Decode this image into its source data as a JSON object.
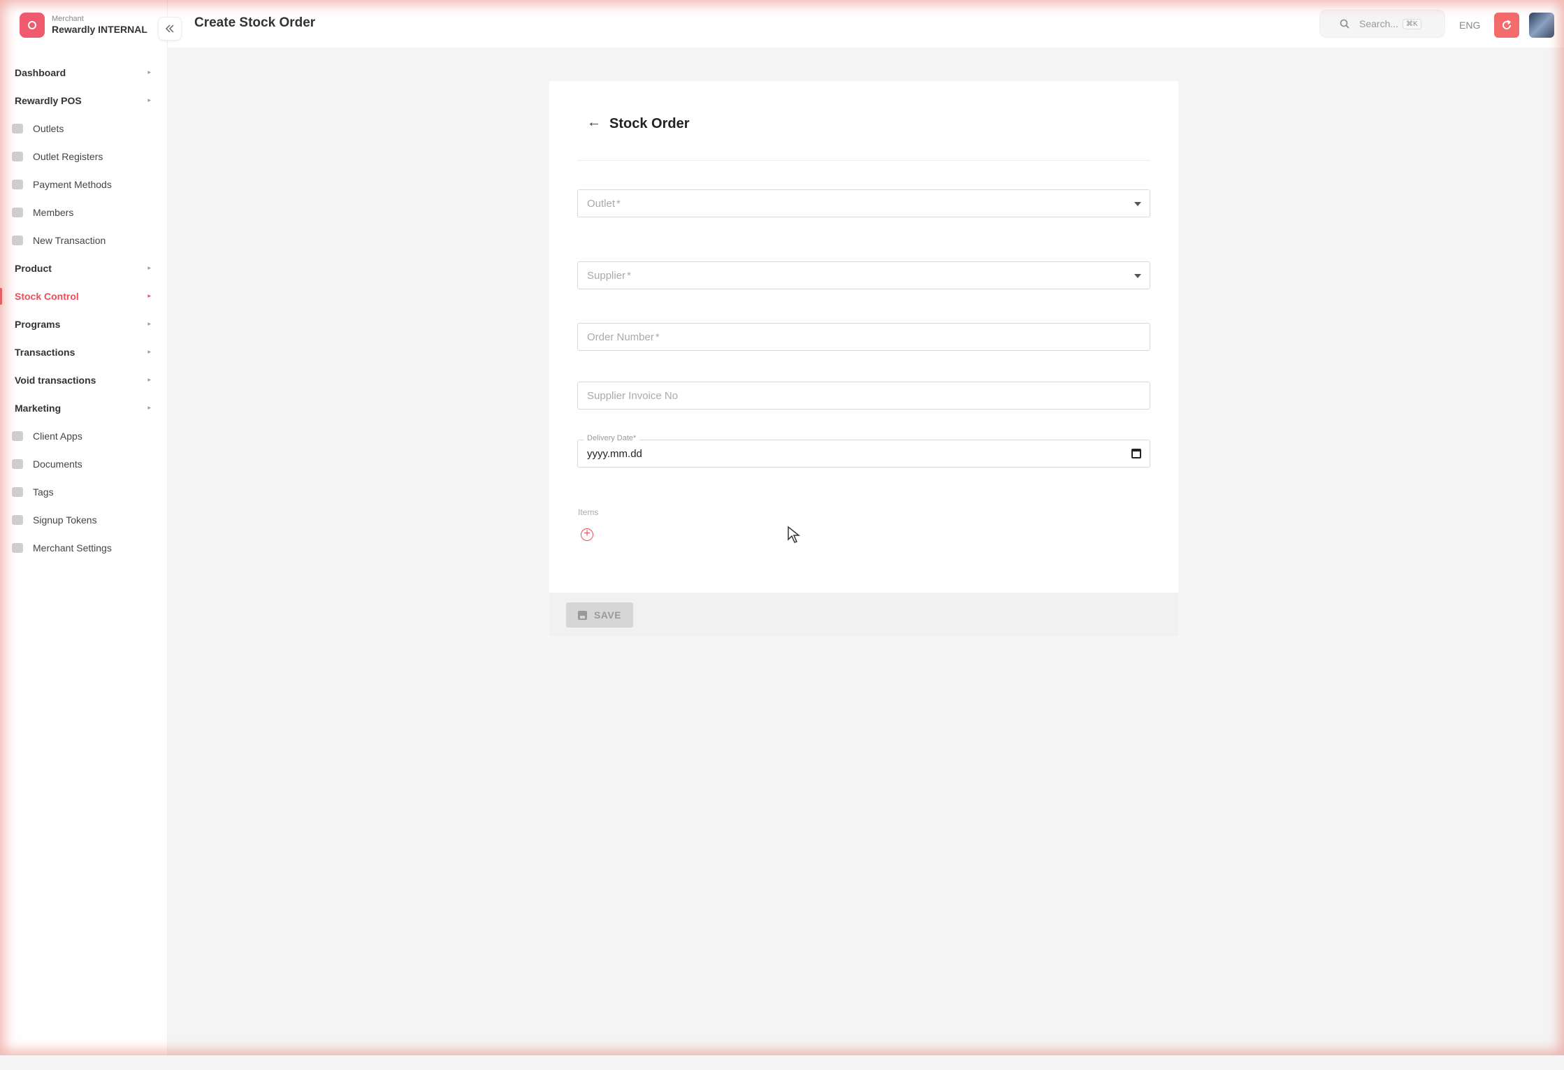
{
  "brand": {
    "sub": "Merchant",
    "name": "Rewardly INTERNAL"
  },
  "header": {
    "title": "Create Stock Order",
    "search_placeholder": "Search...",
    "search_shortcut": "⌘K",
    "language": "ENG"
  },
  "sidebar": {
    "items": [
      {
        "label": "Dashboard",
        "type": "group",
        "icon": ""
      },
      {
        "label": "Rewardly POS",
        "type": "group",
        "icon": ""
      },
      {
        "label": "Outlets",
        "type": "sub",
        "icon": "store-icon"
      },
      {
        "label": "Outlet Registers",
        "type": "sub",
        "icon": "register-icon"
      },
      {
        "label": "Payment Methods",
        "type": "sub",
        "icon": "payment-icon"
      },
      {
        "label": "Members",
        "type": "sub",
        "icon": "member-icon"
      },
      {
        "label": "New Transaction",
        "type": "sub",
        "icon": "transaction-icon"
      },
      {
        "label": "Product",
        "type": "group",
        "icon": ""
      },
      {
        "label": "Stock Control",
        "type": "group",
        "icon": "",
        "active": true
      },
      {
        "label": "Programs",
        "type": "group",
        "icon": ""
      },
      {
        "label": "Transactions",
        "type": "group",
        "icon": ""
      },
      {
        "label": "Void transactions",
        "type": "group",
        "icon": ""
      },
      {
        "label": "Marketing",
        "type": "group",
        "icon": ""
      },
      {
        "label": "Client Apps",
        "type": "sub",
        "icon": "client-apps-icon"
      },
      {
        "label": "Documents",
        "type": "sub",
        "icon": "documents-icon"
      },
      {
        "label": "Tags",
        "type": "sub",
        "icon": "tag-icon"
      },
      {
        "label": "Signup Tokens",
        "type": "sub",
        "icon": "token-icon"
      },
      {
        "label": "Merchant Settings",
        "type": "sub",
        "icon": "settings-icon"
      }
    ]
  },
  "form": {
    "title": "Stock Order",
    "outlet_label": "Outlet",
    "supplier_label": "Supplier",
    "order_number_label": "Order Number",
    "invoice_label": "Supplier Invoice No",
    "delivery_label": "Delivery Date",
    "required_marker": "*",
    "delivery_value": "yyyy.mm.dd",
    "items_label": "Items",
    "save_label": "SAVE"
  },
  "colors": {
    "accent": "#e8505b",
    "brand": "#ef5a6f",
    "refresh": "#f36b6b"
  }
}
